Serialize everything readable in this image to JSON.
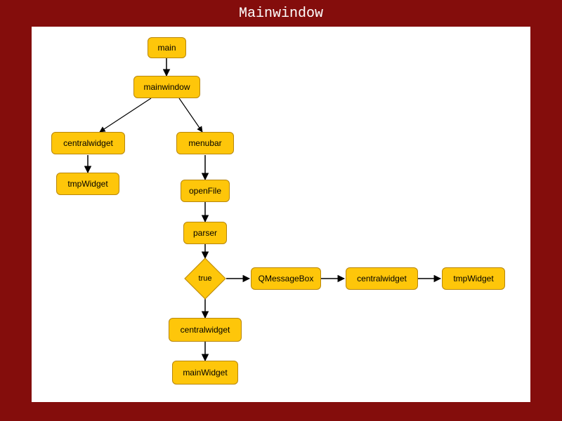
{
  "title": "Mainwindow",
  "nodes": {
    "main": "main",
    "mainwindow": "mainwindow",
    "centralwidget_left": "centralwidget",
    "tmpWidget_left": "tmpWidget",
    "menubar": "menubar",
    "openFile": "openFile",
    "parser": "parser",
    "true": "true",
    "qmessagebox": "QMessageBox",
    "centralwidget_right": "centralwidget",
    "tmpWidget_right": "tmpWidget",
    "centralwidget_bottom": "centralwidget",
    "mainWidget": "mainWidget"
  },
  "colors": {
    "background": "#840d0c",
    "canvas": "#ffffff",
    "node_fill": "#fec60a",
    "node_border": "#b8860b"
  },
  "edges": [
    [
      "main",
      "mainwindow"
    ],
    [
      "mainwindow",
      "centralwidget_left"
    ],
    [
      "mainwindow",
      "menubar"
    ],
    [
      "centralwidget_left",
      "tmpWidget_left"
    ],
    [
      "menubar",
      "openFile"
    ],
    [
      "openFile",
      "parser"
    ],
    [
      "parser",
      "true"
    ],
    [
      "true",
      "qmessagebox"
    ],
    [
      "qmessagebox",
      "centralwidget_right"
    ],
    [
      "centralwidget_right",
      "tmpWidget_right"
    ],
    [
      "true",
      "centralwidget_bottom"
    ],
    [
      "centralwidget_bottom",
      "mainWidget"
    ]
  ]
}
